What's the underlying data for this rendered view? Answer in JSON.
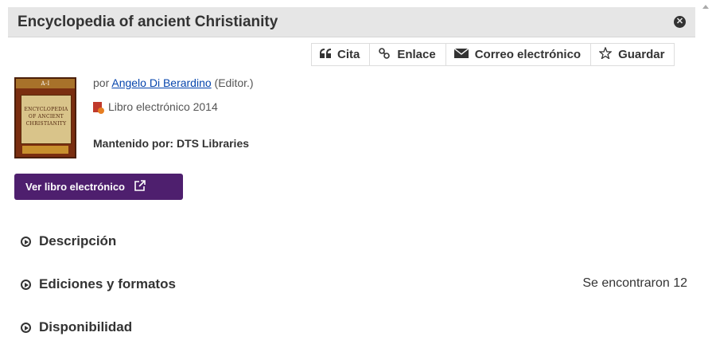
{
  "header": {
    "title": "Encyclopedia of ancient Christianity"
  },
  "toolbar": {
    "cite": "Cita",
    "link": "Enlace",
    "email": "Correo electrónico",
    "save": "Guardar"
  },
  "item": {
    "by_prefix": "por ",
    "author": "Angelo Di Berardino",
    "role": " (Editor.)",
    "format": "Libro electrónico 2014",
    "maintained_by": "Mantenido por: DTS Libraries",
    "view_button": "Ver libro electrónico"
  },
  "cover": {
    "line1": "ENCYCLOPEDIA",
    "line2": "OF ANCIENT",
    "line3": "CHRISTIANITY",
    "vol": "A-I"
  },
  "sections": {
    "description": "Descripción",
    "editions": "Ediciones y formatos",
    "editions_count": "Se encontraron 12",
    "availability": "Disponibilidad"
  },
  "colors": {
    "accent": "#4e1f6e",
    "header_bg": "#e6e6e6",
    "link": "#0645ad"
  }
}
